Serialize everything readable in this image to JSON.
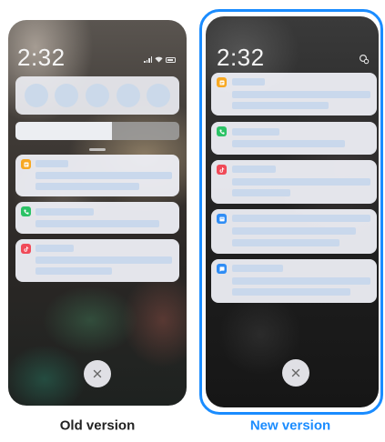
{
  "old_version": {
    "caption": "Old version",
    "time": "2:32",
    "status_icons": [
      "signal-icon",
      "wifi-icon",
      "battery-icon"
    ],
    "quick_settings_toggle_count": 5,
    "brightness_level": 0.59,
    "notifications": [
      {
        "app_icon": "notes-icon",
        "color": "#f7a822"
      },
      {
        "app_icon": "phone-icon",
        "color": "#2bc266"
      },
      {
        "app_icon": "tiktok-icon",
        "color": "#f04a58"
      }
    ]
  },
  "new_version": {
    "caption": "New version",
    "time": "2:32",
    "status_icons": [
      "settings-gear-icon"
    ],
    "notifications": [
      {
        "app_icon": "notes-icon",
        "color": "#f7a822"
      },
      {
        "app_icon": "phone-icon",
        "color": "#2bc266"
      },
      {
        "app_icon": "tiktok-icon",
        "color": "#f04a58"
      },
      {
        "app_icon": "message-icon",
        "color": "#2f8df5"
      },
      {
        "app_icon": "chat-icon",
        "color": "#2f8df5"
      }
    ]
  },
  "colors": {
    "accent": "#1a8cff",
    "notification_bg": "#eeeff5",
    "placeholder_bar": "#c9d8ec",
    "caption_old": "#222222"
  }
}
